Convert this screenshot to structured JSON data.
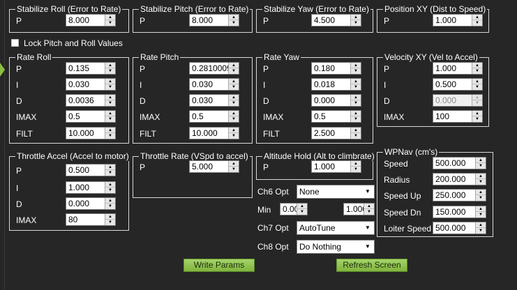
{
  "stabilize_roll": {
    "title": "Stabilize Roll (Error to Rate)",
    "p_label": "P",
    "p_value": "8.000"
  },
  "stabilize_pitch": {
    "title": "Stabilize Pitch (Error to Rate)",
    "p_label": "P",
    "p_value": "8.000"
  },
  "stabilize_yaw": {
    "title": "Stabilize Yaw (Error to Rate)",
    "p_label": "P",
    "p_value": "4.500"
  },
  "position_xy": {
    "title": "Position XY (Dist to Speed)",
    "p_label": "P",
    "p_value": "1.000"
  },
  "lock_pitch_roll": {
    "label": "Lock Pitch and Roll Values",
    "checked": false
  },
  "rate_roll": {
    "title": "Rate Roll",
    "p_label": "P",
    "p_value": "0.135",
    "i_label": "I",
    "i_value": "0.030",
    "d_label": "D",
    "d_value": "0.0036",
    "imax_label": "IMAX",
    "imax_value": "0.5",
    "filt_label": "FILT",
    "filt_value": "10.000"
  },
  "rate_pitch": {
    "title": "Rate Pitch",
    "p_label": "P",
    "p_value": "0.2810009",
    "i_label": "I",
    "i_value": "0.030",
    "d_label": "D",
    "d_value": "0.030",
    "imax_label": "IMAX",
    "imax_value": "0.5",
    "filt_label": "FILT",
    "filt_value": "10.000"
  },
  "rate_yaw": {
    "title": "Rate Yaw",
    "p_label": "P",
    "p_value": "0.180",
    "i_label": "I",
    "i_value": "0.018",
    "d_label": "D",
    "d_value": "0.000",
    "imax_label": "IMAX",
    "imax_value": "0.5",
    "filt_label": "FILT",
    "filt_value": "2.500"
  },
  "velocity_xy": {
    "title": "Velocity XY (Vel to Accel)",
    "p_label": "P",
    "p_value": "1.000",
    "i_label": "I",
    "i_value": "0.500",
    "d_label": "D",
    "d_value": "0.000",
    "imax_label": "IMAX",
    "imax_value": "100"
  },
  "throttle_accel": {
    "title": "Throttle Accel (Accel to motor)",
    "p_label": "P",
    "p_value": "0.500",
    "i_label": "I",
    "i_value": "1.000",
    "d_label": "D",
    "d_value": "0.000",
    "imax_label": "IMAX",
    "imax_value": "80"
  },
  "throttle_rate": {
    "title": "Throttle Rate (VSpd to accel)",
    "p_label": "P",
    "p_value": "5.000"
  },
  "altitude_hold": {
    "title": "Altitude Hold (Alt to climbrate)",
    "p_label": "P",
    "p_value": "1.000"
  },
  "ch6": {
    "label": "Ch6 Opt",
    "value": "None"
  },
  "min_max": {
    "label": "Min",
    "min_value": "0.000",
    "max_value": "1.000"
  },
  "ch7": {
    "label": "Ch7 Opt",
    "value": "AutoTune"
  },
  "ch8": {
    "label": "Ch8 Opt",
    "value": "Do Nothing"
  },
  "wpnav": {
    "title": "WPNav (cm's)",
    "speed_label": "Speed",
    "speed_value": "500.000",
    "radius_label": "Radius",
    "radius_value": "200.000",
    "speed_up_label": "Speed Up",
    "speed_up_value": "250.000",
    "speed_dn_label": "Speed Dn",
    "speed_dn_value": "150.000",
    "loiter_label": "Loiter Speed",
    "loiter_value": "500.000"
  },
  "buttons": {
    "write_params": "Write Params",
    "refresh_screen": "Refresh Screen"
  },
  "colors": {
    "background": "#262626",
    "button_green": "#8cc34a"
  }
}
